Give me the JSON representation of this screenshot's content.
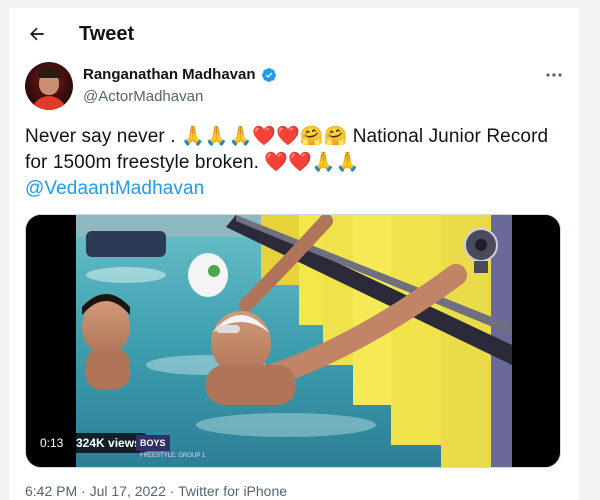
{
  "header": {
    "title": "Tweet",
    "back_icon": "arrow-left-icon"
  },
  "author": {
    "name": "Ranganathan Madhavan",
    "handle": "@ActorMadhavan",
    "verified_color": "#1d9bf0"
  },
  "tweet": {
    "text_line1a": "Never say never .",
    "emoji_line1": "🙏🙏🙏❤️❤️🤗🤗",
    "text_line1b": "National Junior",
    "text_line2a": "Record for 1500m freestyle broken.",
    "emoji_line2": "❤️❤️🙏🙏",
    "mention": "@VedaantMadhavan"
  },
  "media": {
    "elapsed": "0:13",
    "views": "324K views",
    "caption": "BOYS",
    "caption_sub": "FREESTYLE, GROUP 1"
  },
  "meta": {
    "time": "6:42 PM",
    "date": "Jul 17, 2022",
    "sep": "·",
    "source": "Twitter for iPhone"
  },
  "colors": {
    "accent": "#1d9bf0",
    "muted": "#536471",
    "text": "#0f1419"
  }
}
